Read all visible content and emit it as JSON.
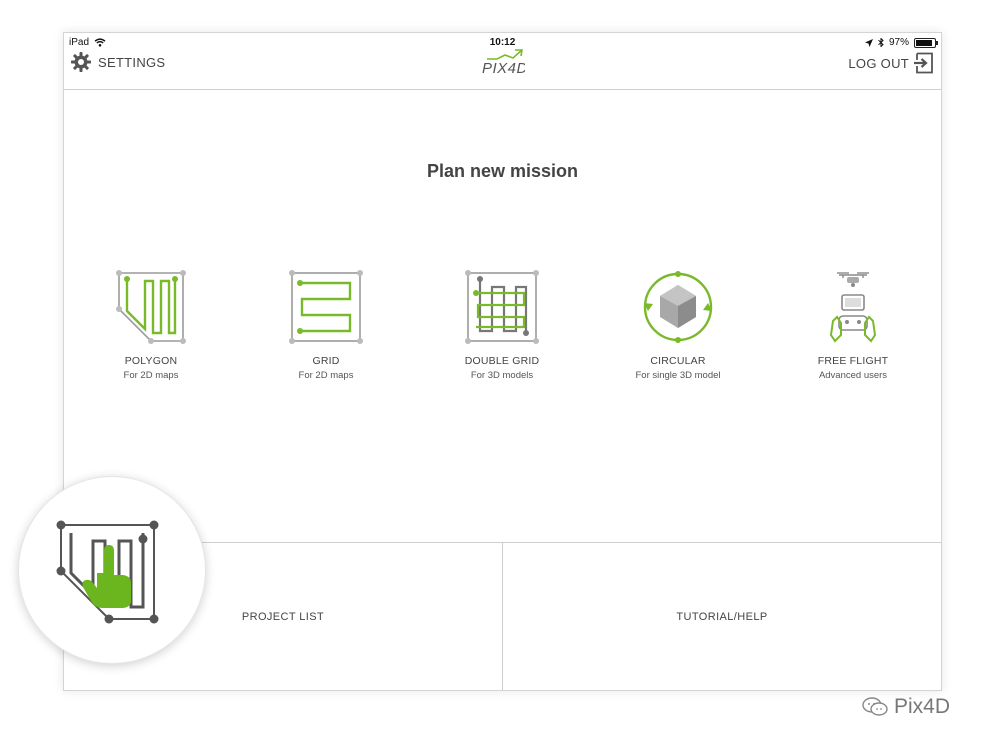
{
  "status_bar": {
    "device": "iPad",
    "time": "10:12",
    "battery": "97%",
    "battery_fraction": 0.97
  },
  "nav": {
    "settings_label": "SETTINGS",
    "logo_text": "PIX4D",
    "logout_label": "LOG OUT"
  },
  "main": {
    "title": "Plan new mission"
  },
  "missions": [
    {
      "label": "POLYGON",
      "sub": "For 2D maps",
      "icon": "polygon-mission-icon"
    },
    {
      "label": "GRID",
      "sub": "For 2D maps",
      "icon": "grid-mission-icon"
    },
    {
      "label": "DOUBLE GRID",
      "sub": "For 3D models",
      "icon": "double-grid-mission-icon"
    },
    {
      "label": "CIRCULAR",
      "sub": "For single 3D model",
      "icon": "circular-mission-icon"
    },
    {
      "label": "FREE FLIGHT",
      "sub": "Advanced users",
      "icon": "free-flight-icon"
    }
  ],
  "bottom": {
    "project_list": "PROJECT LIST",
    "tutorial_help": "TUTORIAL/HELP"
  },
  "watermark": {
    "text": "Pix4D"
  },
  "colors": {
    "accent_green": "#7ab929",
    "hand_green": "#6bb51f",
    "grey": "#9a9a9a",
    "dark": "#555555"
  }
}
